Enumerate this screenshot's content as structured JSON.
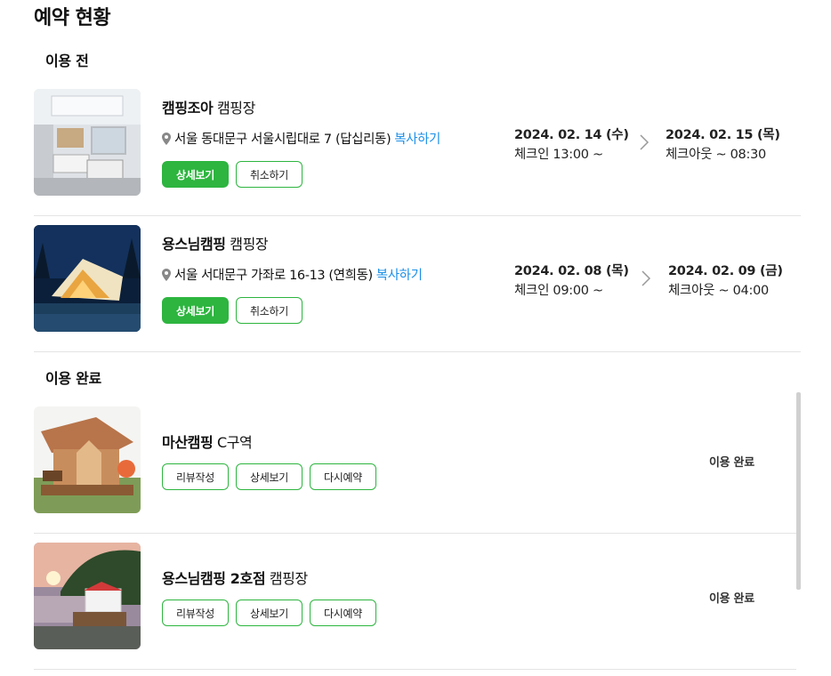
{
  "page": {
    "title": "예약 현황"
  },
  "sections": {
    "before": {
      "title": "이용 전"
    },
    "done": {
      "title": "이용 완료"
    }
  },
  "upcoming": [
    {
      "name_bold": "캠핑조아",
      "name_suffix": " 캠핑장",
      "address": "서울 동대문구 서울시립대로 7 (답십리동)",
      "copy_label": "복사하기",
      "detail_label": "상세보기",
      "cancel_label": "취소하기",
      "checkin_date": "2024. 02. 14 (수)",
      "checkin_time": "체크인 13:00 ~",
      "checkout_date": "2024. 02. 15 (목)",
      "checkout_time": "체크아웃 ~ 08:30"
    },
    {
      "name_bold": "용스님캠핑",
      "name_suffix": " 캠핑장",
      "address": "서울 서대문구 가좌로 16-13 (연희동)",
      "copy_label": "복사하기",
      "detail_label": "상세보기",
      "cancel_label": "취소하기",
      "checkin_date": "2024. 02. 08 (목)",
      "checkin_time": "체크인 09:00 ~",
      "checkout_date": "2024. 02. 09 (금)",
      "checkout_time": "체크아웃 ~ 04:00"
    }
  ],
  "completed": [
    {
      "name_bold": "마산캠핑",
      "name_suffix": " C구역",
      "review_label": "리뷰작성",
      "detail_label": "상세보기",
      "rebook_label": "다시예약",
      "status": "이용 완료"
    },
    {
      "name_bold": "용스님캠핑 2호점",
      "name_suffix": " 캠핑장",
      "review_label": "리뷰작성",
      "detail_label": "상세보기",
      "rebook_label": "다시예약",
      "status": "이용 완료"
    }
  ],
  "colors": {
    "accent": "#2db53f",
    "link": "#1a8fe8",
    "divider": "#e4e4e4"
  },
  "icons": {
    "pin": "map-pin-icon",
    "arrow": "chevron-right-icon"
  }
}
